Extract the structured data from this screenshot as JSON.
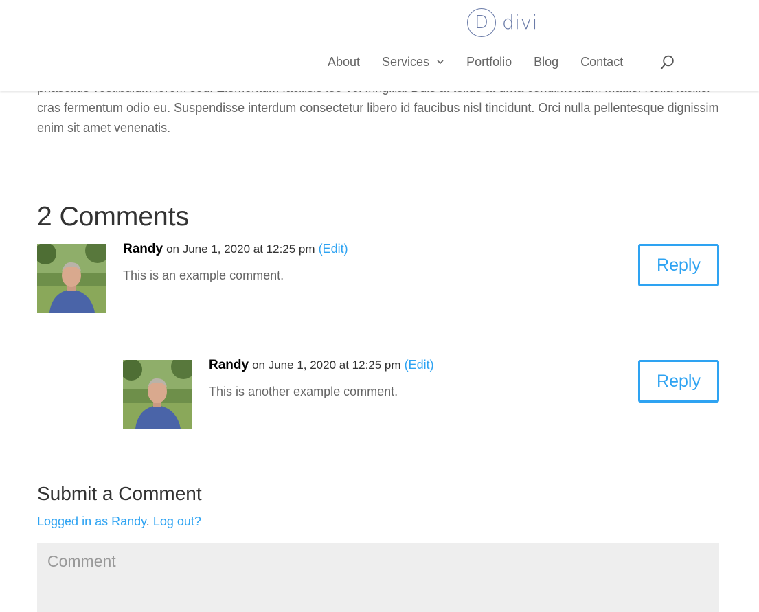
{
  "brand": {
    "logo_letter": "D",
    "logo_text": "divi"
  },
  "nav": {
    "items": [
      {
        "label": "About"
      },
      {
        "label": "Services"
      },
      {
        "label": "Portfolio"
      },
      {
        "label": "Blog"
      },
      {
        "label": "Contact"
      }
    ]
  },
  "post": {
    "intro_text": "phasellus vestibulum lorem sed. Elementum facilisis leo vel fringilla. Duis at tellus at urna condimentum mattis. Nulla facilisi cras fermentum odio eu. Suspendisse interdum consectetur libero id faucibus nisl tincidunt. Orci nulla pellentesque dignissim enim sit amet venenatis."
  },
  "comments": {
    "title": "2 Comments",
    "items": [
      {
        "author": "Randy",
        "date": "on June 1, 2020 at 12:25 pm",
        "edit_label": "(Edit)",
        "text": "This is an example comment.",
        "reply_label": "Reply"
      },
      {
        "author": "Randy",
        "date": "on June 1, 2020 at 12:25 pm",
        "edit_label": "(Edit)",
        "text": "This is another example comment.",
        "reply_label": "Reply"
      }
    ]
  },
  "submit": {
    "title": "Submit a Comment",
    "logged_in_label": "Logged in as Randy",
    "separator": ".",
    "logout_label": "Log out?",
    "comment_placeholder": "Comment"
  },
  "colors": {
    "accent": "#2ea3f2",
    "brand": "#6a7ba8",
    "text": "#666666",
    "heading": "#333333"
  }
}
